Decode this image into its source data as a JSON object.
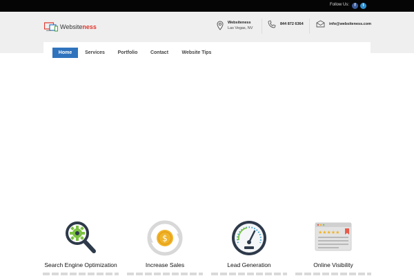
{
  "topbar": {
    "follow_label": "Follow Us:",
    "social": [
      {
        "name": "facebook-icon",
        "glyph": "f"
      },
      {
        "name": "twitter-icon",
        "glyph": "t"
      }
    ]
  },
  "header": {
    "logo_text_main": "Website",
    "logo_text_accent": "ness",
    "address_line1": "Websiteness",
    "address_line2": "Las Vegas, NV",
    "phone": "844 872 6364",
    "email": "info@websiteness.com"
  },
  "nav": {
    "items": [
      {
        "label": "Home",
        "active": true
      },
      {
        "label": "Services",
        "active": false
      },
      {
        "label": "Portfolio",
        "active": false
      },
      {
        "label": "Contact",
        "active": false
      },
      {
        "label": "Website Tips",
        "active": false
      }
    ]
  },
  "features": [
    {
      "title": "Search Engine Optimization",
      "icon": "seo-gear-magnifier-icon"
    },
    {
      "title": "Increase Sales",
      "icon": "dollar-coin-cycle-icon"
    },
    {
      "title": "Lead Generation",
      "icon": "speedometer-icon"
    },
    {
      "title": "Online Visibility",
      "icon": "browser-rating-icon"
    }
  ],
  "colors": {
    "topbar_bg": "#050505",
    "header_bg": "#efefef",
    "nav_active": "#2f73bd",
    "logo_accent": "#e0362c"
  }
}
